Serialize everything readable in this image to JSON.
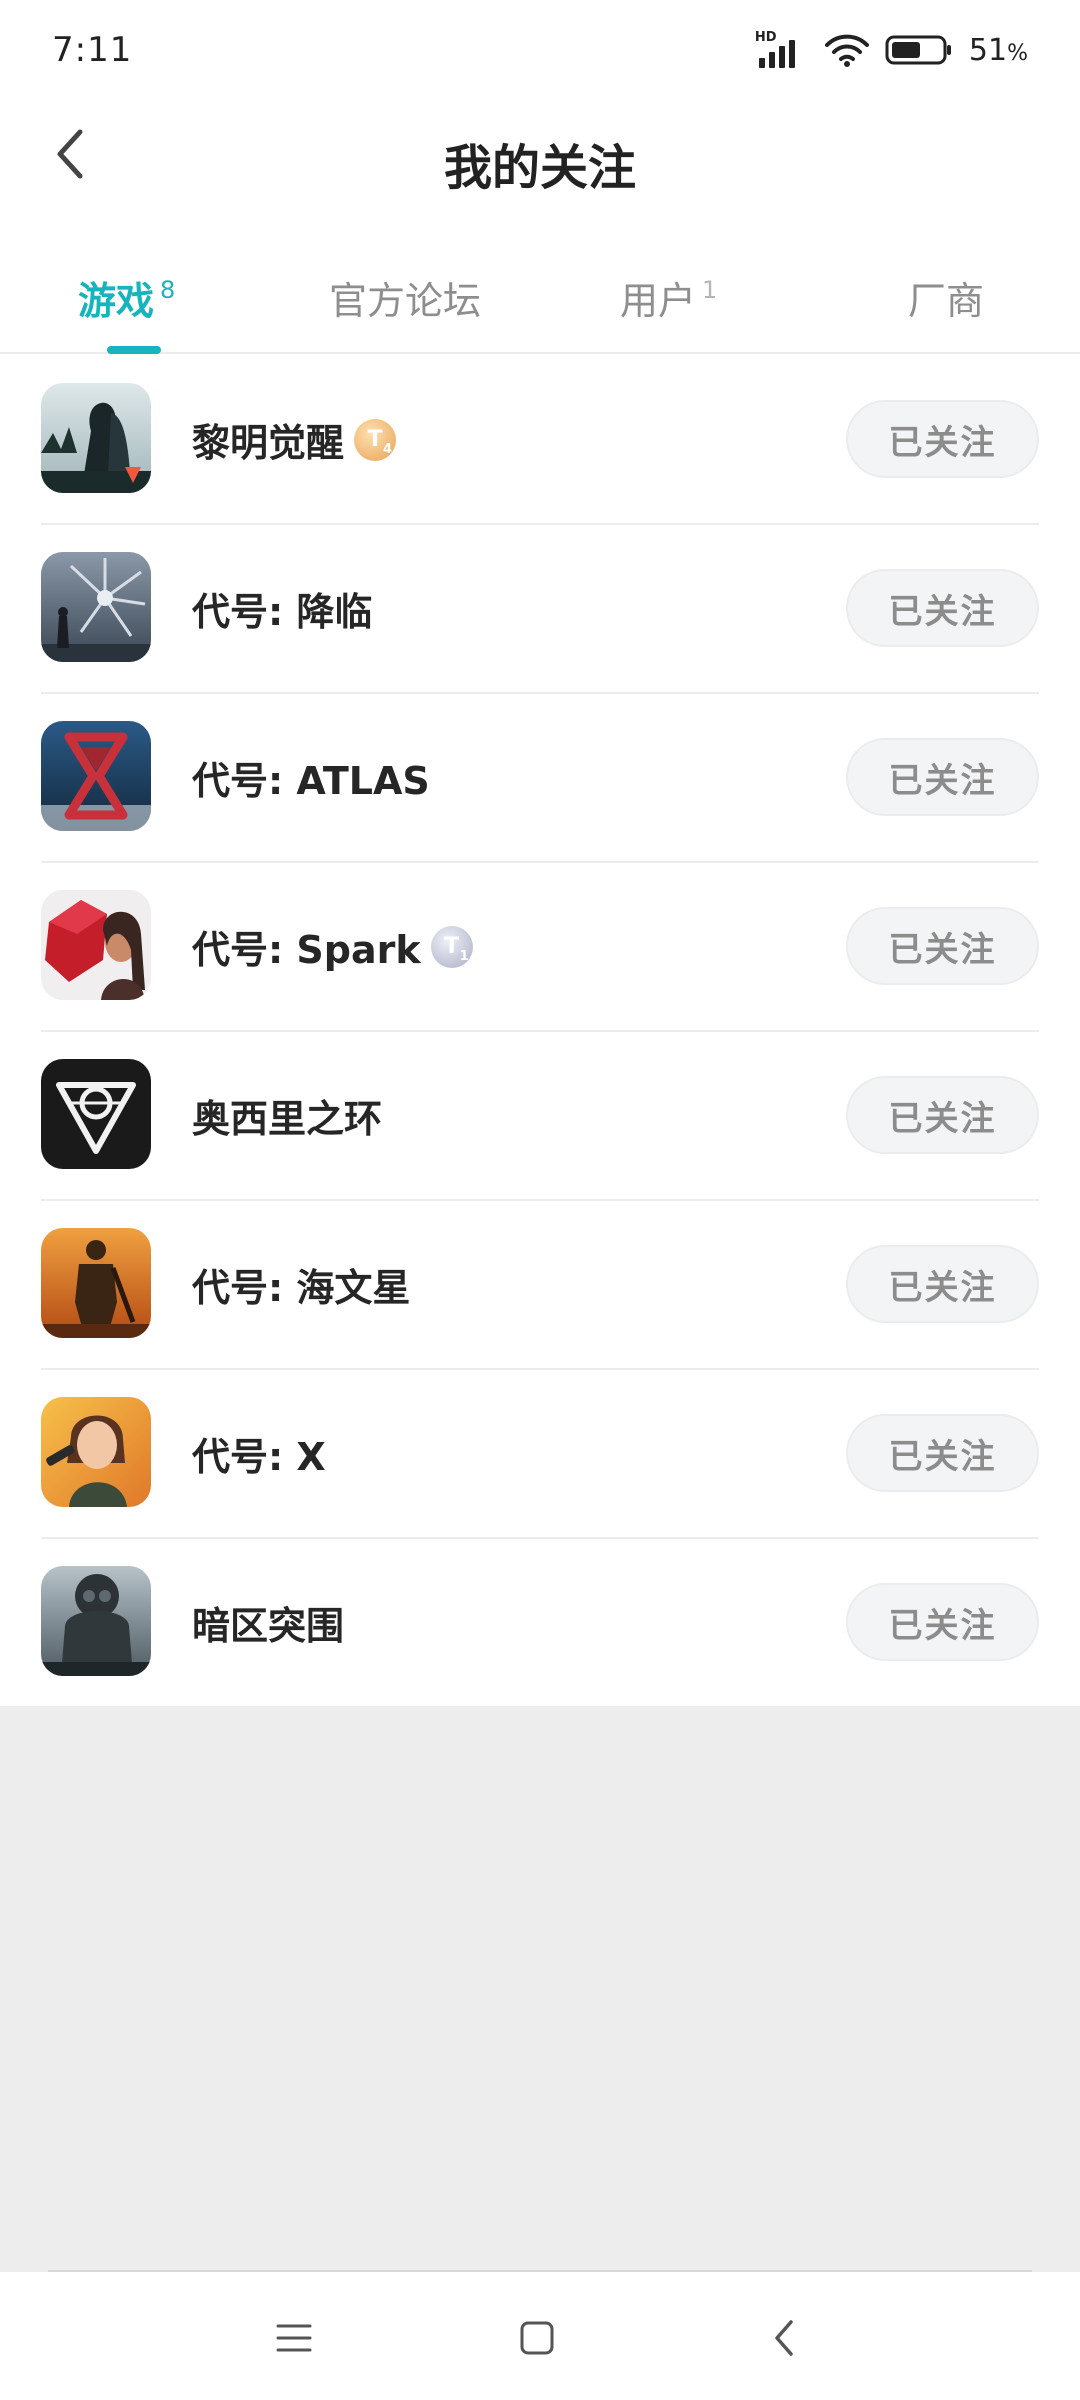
{
  "status_bar": {
    "time": "7:11",
    "network": "HD",
    "battery": "51",
    "battery_unit": "%"
  },
  "header": {
    "back_icon": "chevron-left-icon",
    "title": "我的关注"
  },
  "tabs": [
    {
      "label": "游戏",
      "count": "8",
      "active": true
    },
    {
      "label": "官方论坛",
      "count": "",
      "active": false
    },
    {
      "label": "用户",
      "count": "1",
      "active": false
    },
    {
      "label": "厂商",
      "count": "",
      "active": false
    }
  ],
  "follow_label": "已关注",
  "games": [
    {
      "name": "黎明觉醒",
      "badge": "T",
      "badge_level": "4",
      "badge_color": "#e6a355"
    },
    {
      "name": "代号: 降临"
    },
    {
      "name": "代号: ATLAS"
    },
    {
      "name": "代号: Spark",
      "badge": "T",
      "badge_level": "1",
      "badge_color": "#a9aec4"
    },
    {
      "name": "奥西里之环"
    },
    {
      "name": "代号: 海文星"
    },
    {
      "name": "代号: X"
    },
    {
      "name": "暗区突围"
    }
  ],
  "colors": {
    "accent": "#16b5bd",
    "list_bg": "#ffffff",
    "empty_bg": "#ededed"
  },
  "nav_bar": {
    "menu_icon": "menu-icon",
    "home_icon": "home-square-icon",
    "back_icon": "back-triangle-icon"
  }
}
